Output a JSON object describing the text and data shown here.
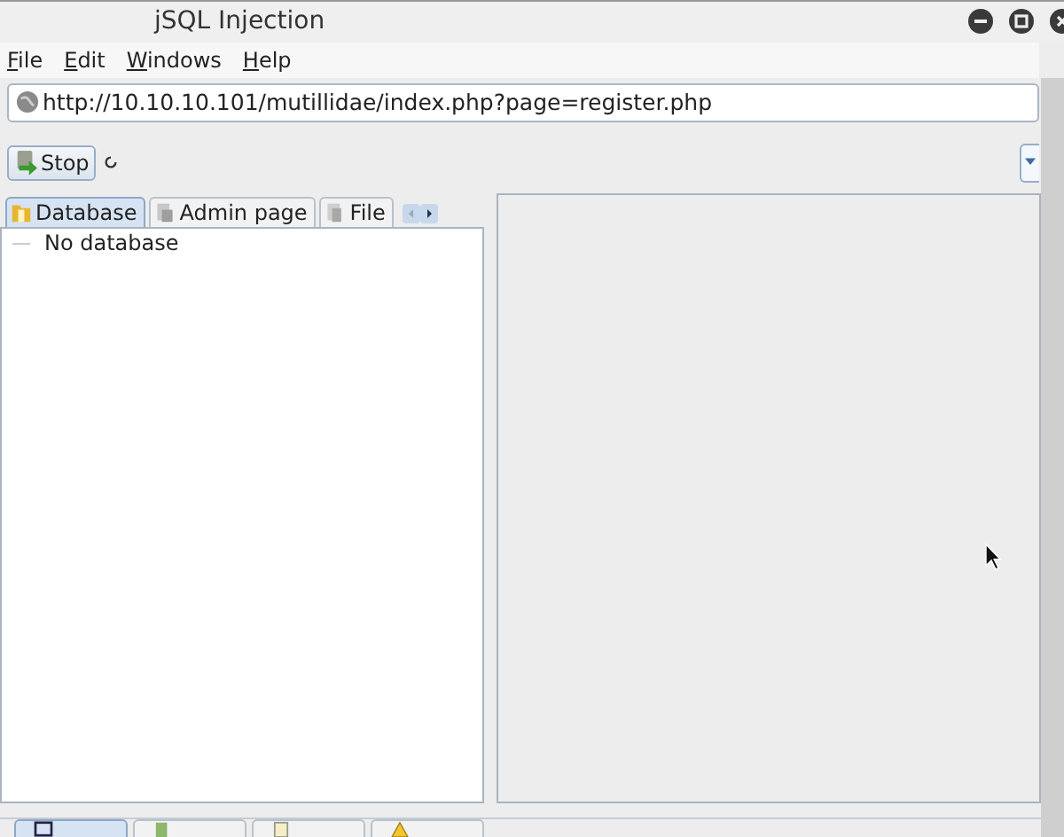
{
  "window": {
    "title": "jSQL Injection"
  },
  "menu": [
    {
      "mnemonic": "F",
      "rest": "ile"
    },
    {
      "mnemonic": "E",
      "rest": "dit"
    },
    {
      "mnemonic": "W",
      "rest": "indows"
    },
    {
      "mnemonic": "H",
      "rest": "elp"
    }
  ],
  "address": {
    "value": "http://10.10.10.101/mutillidae/index.php?page=register.php"
  },
  "toolbar": {
    "stop_button": "Stop"
  },
  "tabs": [
    {
      "label": "Database",
      "selected": true
    },
    {
      "label": "Admin page",
      "selected": false
    },
    {
      "label": "File",
      "selected": false
    }
  ],
  "tree": {
    "items": [
      {
        "label": "No database"
      }
    ]
  },
  "bottom_tabs": [
    {
      "selected": true
    },
    {
      "selected": false
    },
    {
      "selected": false
    },
    {
      "selected": false
    }
  ]
}
